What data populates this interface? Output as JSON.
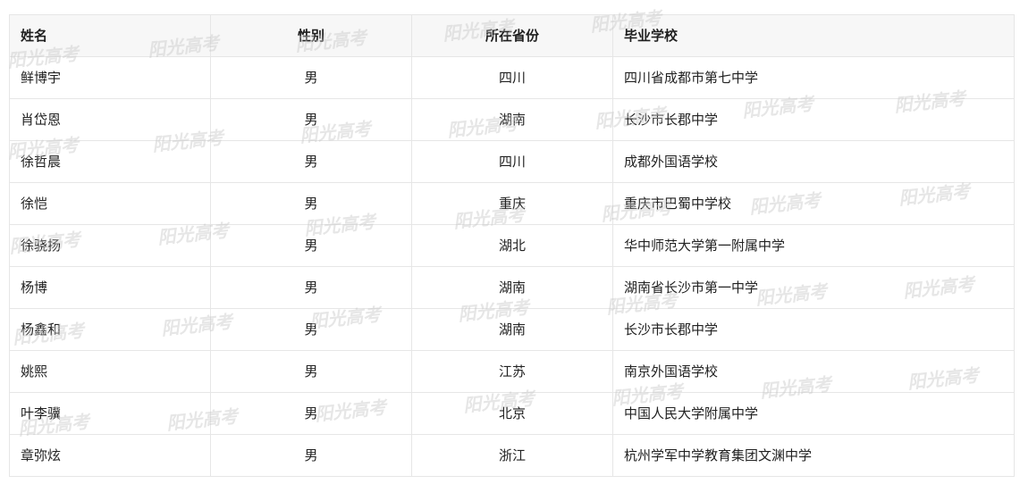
{
  "table": {
    "headers": [
      "姓名",
      "性别",
      "所在省份",
      "毕业学校"
    ],
    "rows": [
      {
        "name": "鲜博宇",
        "gender": "男",
        "province": "四川",
        "school": "四川省成都市第七中学"
      },
      {
        "name": "肖岱恩",
        "gender": "男",
        "province": "湖南",
        "school": "长沙市长郡中学"
      },
      {
        "name": "徐哲晨",
        "gender": "男",
        "province": "四川",
        "school": "成都外国语学校"
      },
      {
        "name": "徐恺",
        "gender": "男",
        "province": "重庆",
        "school": "重庆市巴蜀中学校"
      },
      {
        "name": "徐骁扬",
        "gender": "男",
        "province": "湖北",
        "school": "华中师范大学第一附属中学"
      },
      {
        "name": "杨博",
        "gender": "男",
        "province": "湖南",
        "school": "湖南省长沙市第一中学"
      },
      {
        "name": "杨鑫和",
        "gender": "男",
        "province": "湖南",
        "school": "长沙市长郡中学"
      },
      {
        "name": "姚熙",
        "gender": "男",
        "province": "江苏",
        "school": "南京外国语学校"
      },
      {
        "name": "叶李骥",
        "gender": "男",
        "province": "北京",
        "school": "中国人民大学附属中学"
      },
      {
        "name": "章弥炫",
        "gender": "男",
        "province": "浙江",
        "school": "杭州学军中学教育集团文渊中学"
      }
    ]
  },
  "watermark_text": "阳光高考"
}
